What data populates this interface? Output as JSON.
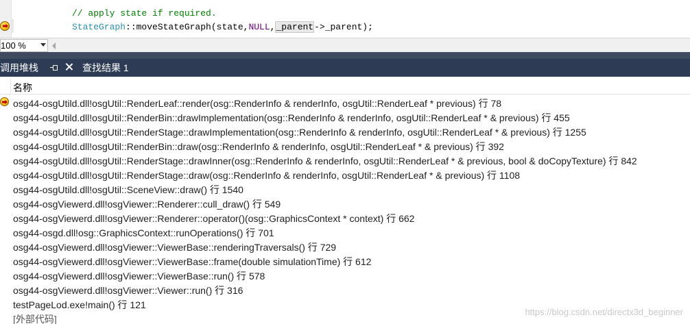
{
  "editor": {
    "comment_line": "// apply state if required.",
    "code_line": {
      "type_name": "StateGraph",
      "call": "::moveStateGraph(state,",
      "null_kw": "NULL",
      "comma": ",",
      "parent_highlight": "_parent",
      "rest": "->_parent);"
    }
  },
  "zoom": {
    "value": "100 %"
  },
  "tabs": {
    "active_label": "调用堆栈",
    "inactive_label": "查找结果 1"
  },
  "list": {
    "column_header": "名称",
    "rows": [
      "osg44-osgUtild.dll!osgUtil::RenderLeaf::render(osg::RenderInfo & renderInfo, osgUtil::RenderLeaf * previous) 行 78",
      "osg44-osgUtild.dll!osgUtil::RenderBin::drawImplementation(osg::RenderInfo & renderInfo, osgUtil::RenderLeaf * & previous) 行 455",
      "osg44-osgUtild.dll!osgUtil::RenderStage::drawImplementation(osg::RenderInfo & renderInfo, osgUtil::RenderLeaf * & previous) 行 1255",
      "osg44-osgUtild.dll!osgUtil::RenderBin::draw(osg::RenderInfo & renderInfo, osgUtil::RenderLeaf * & previous) 行 392",
      "osg44-osgUtild.dll!osgUtil::RenderStage::drawInner(osg::RenderInfo & renderInfo, osgUtil::RenderLeaf * & previous, bool & doCopyTexture) 行 842",
      "osg44-osgUtild.dll!osgUtil::RenderStage::draw(osg::RenderInfo & renderInfo, osgUtil::RenderLeaf * & previous) 行 1108",
      "osg44-osgUtild.dll!osgUtil::SceneView::draw() 行 1540",
      "osg44-osgViewerd.dll!osgViewer::Renderer::cull_draw() 行 549",
      "osg44-osgViewerd.dll!osgViewer::Renderer::operator()(osg::GraphicsContext * context) 行 662",
      "osg44-osgd.dll!osg::GraphicsContext::runOperations() 行 701",
      "osg44-osgViewerd.dll!osgViewer::ViewerBase::renderingTraversals() 行 729",
      "osg44-osgViewerd.dll!osgViewer::ViewerBase::frame(double simulationTime) 行 612",
      "osg44-osgViewerd.dll!osgViewer::ViewerBase::run() 行 578",
      "osg44-osgViewerd.dll!osgViewer::Viewer::run() 行 316",
      "testPageLod.exe!main() 行 121",
      "[外部代码]"
    ]
  },
  "watermark": "https://blog.csdn.net/directx3d_beginner"
}
